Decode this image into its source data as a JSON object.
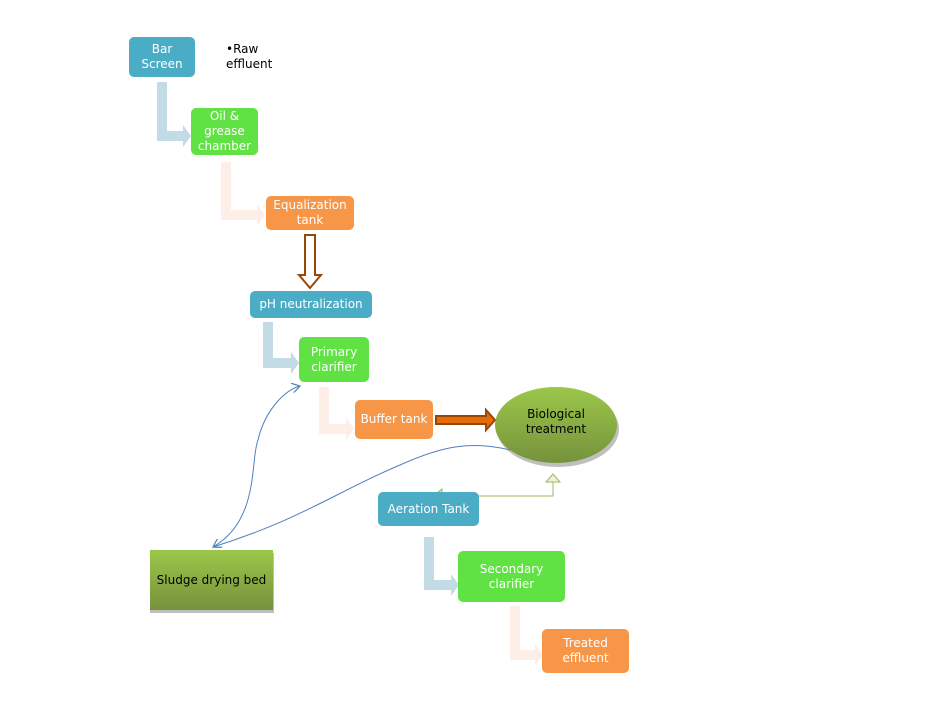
{
  "nodes": {
    "bar_screen": "Bar Screen",
    "raw_effluent": "•Raw effluent",
    "oil_grease": "Oil & grease chamber",
    "equalization": "Equalization tank",
    "ph": "pH neutralization",
    "primary": "Primary clarifier",
    "buffer": "Buffer tank",
    "biological": "Biological treatment",
    "aeration": "Aeration Tank",
    "secondary": "Secondary clarifier",
    "treated": "Treated effluent",
    "sludge": "Sludge drying bed"
  },
  "colors": {
    "blue": "#4bacc6",
    "green": "#61e244",
    "orange": "#f79646",
    "olive": "#8aae3e",
    "brown": "#974706",
    "connector_blue": "#c2dbe4",
    "connector_pink": "#fdeee8",
    "curve": "#4f81bd"
  }
}
